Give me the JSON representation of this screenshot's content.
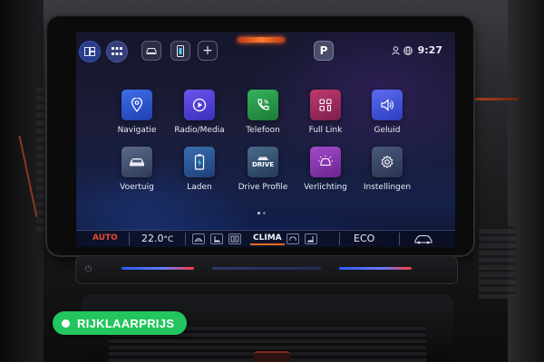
{
  "status_bar": {
    "park_label": "P",
    "add_label": "+",
    "time": "9:27",
    "icons": [
      "home-icon",
      "apps-grid-icon",
      "car-icon",
      "phone-battery-icon",
      "add-icon",
      "park-icon",
      "user-icon",
      "globe-icon"
    ]
  },
  "apps": [
    {
      "label": "Navigatie",
      "icon": "map-pin-icon",
      "color": "#3e6fe8"
    },
    {
      "label": "Radio/Media",
      "icon": "play-icon",
      "color": "#6b55f0"
    },
    {
      "label": "Telefoon",
      "icon": "phone-icon",
      "color": "#36b35a"
    },
    {
      "label": "Full Link",
      "icon": "full-link-icon",
      "color": "#c03a6a"
    },
    {
      "label": "Geluid",
      "icon": "speaker-icon",
      "color": "#5a6cf0"
    },
    {
      "label": "Voertuig",
      "icon": "car-icon",
      "color": "#5b6a8a"
    },
    {
      "label": "Laden",
      "icon": "charging-icon",
      "color": "#3a6fb0"
    },
    {
      "label": "Drive Profile",
      "icon": "drive-profile-icon",
      "tile_text": "DRIVE",
      "color": "#4a6a8a"
    },
    {
      "label": "Verlichting",
      "icon": "lighting-icon",
      "color": "#a24ac8"
    },
    {
      "label": "Instellingen",
      "icon": "gear-icon",
      "color": "#4a5a7a"
    }
  ],
  "climate_bar": {
    "auto_label": "AUTO",
    "temperature": "22.0",
    "temperature_unit": "°C",
    "clima_label": "CLIMA",
    "eco_label": "ECO"
  },
  "badge": {
    "label": "RIJKLAARPRIJS",
    "color": "#22c55e"
  }
}
